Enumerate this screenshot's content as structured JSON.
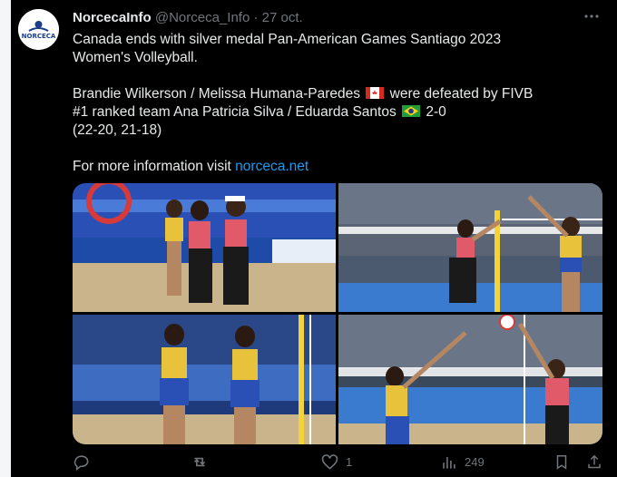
{
  "tweet": {
    "author_name": "NorcecaInfo",
    "handle": "@Norceca_Info",
    "separator": "·",
    "date": "27 oct.",
    "avatar_text": "NORCECA",
    "line1": "Canada ends with silver medal Pan-American Games Santiago 2023",
    "line2": "Women's Volleyball.",
    "line3a": "Brandie Wilkerson / Melissa Humana-Paredes",
    "line3b": "were defeated by FIVB",
    "line4a": "#1 ranked team Ana Patricia Silva / Eduarda Santos",
    "line4b": "2-0",
    "line5": "(22-20, 21-18)",
    "line6a": "For more information visit",
    "link": "norceca.net"
  },
  "actions": {
    "likes": "1",
    "views": "249"
  },
  "colors": {
    "background": "#000000",
    "text": "#e7e9ea",
    "muted": "#71767b",
    "link": "#1d9bf0"
  },
  "icons": [
    "more-icon",
    "reply-icon",
    "retweet-icon",
    "like-icon",
    "views-icon",
    "bookmark-icon",
    "share-icon",
    "canada-flag-icon",
    "brazil-flag-icon"
  ]
}
